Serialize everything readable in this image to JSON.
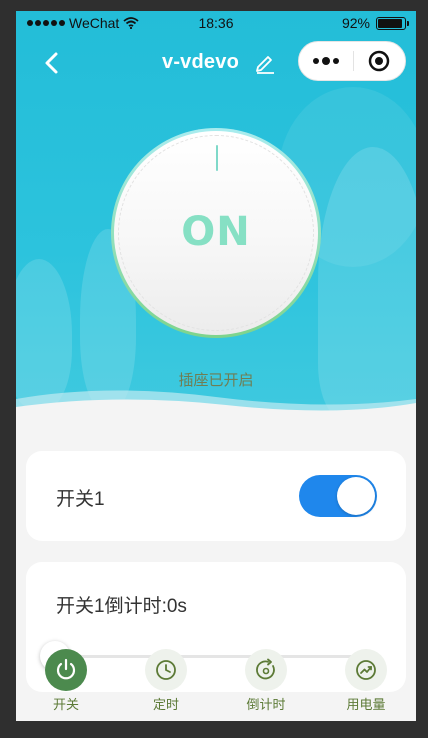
{
  "status_bar": {
    "carrier": "WeChat",
    "time": "18:36",
    "battery_text": "92%",
    "battery_level": 0.92
  },
  "nav": {
    "title": "v-vdevo",
    "back_icon": "chevron-left-icon",
    "edit_icon": "pencil-icon",
    "more_icon": "more-dots-icon",
    "close_icon": "target-circle-icon"
  },
  "dial": {
    "state_text": "ON"
  },
  "hero": {
    "status_text": "插座已开启"
  },
  "switch_card": {
    "label": "开关1",
    "on": true
  },
  "countdown_card": {
    "label": "开关1倒计时:0s",
    "slider_value": 0
  },
  "tabs": [
    {
      "label": "开关",
      "icon": "power-icon",
      "active": true
    },
    {
      "label": "定时",
      "icon": "clock-icon",
      "active": false
    },
    {
      "label": "倒计时",
      "icon": "countdown-icon",
      "active": false
    },
    {
      "label": "用电量",
      "icon": "chart-trend-icon",
      "active": false
    }
  ],
  "colors": {
    "hero": "#23bdd8",
    "toggle_on": "#1f87ec",
    "tab_active": "#4c8a4e",
    "tab_label": "#5c7a36"
  }
}
